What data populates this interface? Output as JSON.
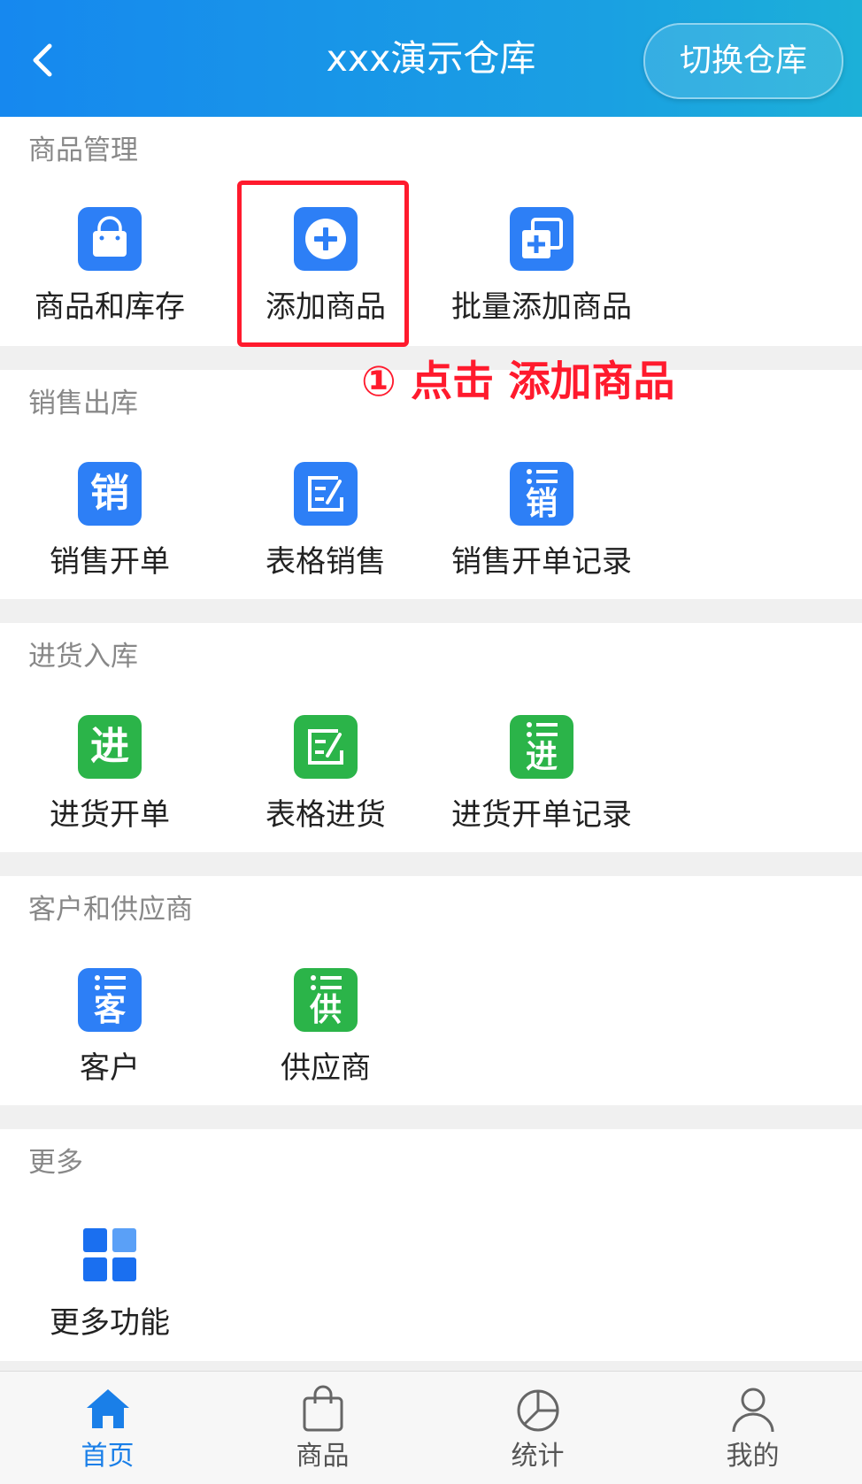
{
  "header": {
    "title": "xxx演示仓库",
    "switch_label": "切换仓库"
  },
  "sections": [
    {
      "title": "商品管理",
      "items": [
        {
          "label": "商品和库存",
          "icon": "shopping-bag-icon"
        },
        {
          "label": "添加商品",
          "icon": "add-circle-icon"
        },
        {
          "label": "批量添加商品",
          "icon": "batch-add-icon"
        }
      ]
    },
    {
      "title": "销售出库",
      "items": [
        {
          "label": "销售开单",
          "icon": "sales-icon",
          "glyph": "销"
        },
        {
          "label": "表格销售",
          "icon": "table-edit-icon"
        },
        {
          "label": "销售开单记录",
          "icon": "sales-record-icon",
          "glyph": "销"
        }
      ]
    },
    {
      "title": "进货入库",
      "items": [
        {
          "label": "进货开单",
          "icon": "purchase-icon",
          "glyph": "进"
        },
        {
          "label": "表格进货",
          "icon": "table-edit-icon"
        },
        {
          "label": "进货开单记录",
          "icon": "purchase-record-icon",
          "glyph": "进"
        }
      ]
    },
    {
      "title": "客户和供应商",
      "items": [
        {
          "label": "客户",
          "icon": "customer-icon",
          "glyph": "客"
        },
        {
          "label": "供应商",
          "icon": "supplier-icon",
          "glyph": "供"
        }
      ]
    },
    {
      "title": "更多",
      "items": [
        {
          "label": "更多功能",
          "icon": "grid-icon"
        }
      ]
    }
  ],
  "annotation": "① 点击 添加商品",
  "tabbar": [
    {
      "label": "首页",
      "icon": "home-icon",
      "active": true
    },
    {
      "label": "商品",
      "icon": "bag-icon",
      "active": false
    },
    {
      "label": "统计",
      "icon": "pie-chart-icon",
      "active": false
    },
    {
      "label": "我的",
      "icon": "user-icon",
      "active": false
    }
  ],
  "colors": {
    "header_start": "#1688ef",
    "header_end": "#1cb0d8",
    "icon_blue": "#2d7ff6",
    "icon_green": "#2bb449",
    "highlight_red": "#ff1a2d",
    "tab_active": "#1a7fe8"
  }
}
